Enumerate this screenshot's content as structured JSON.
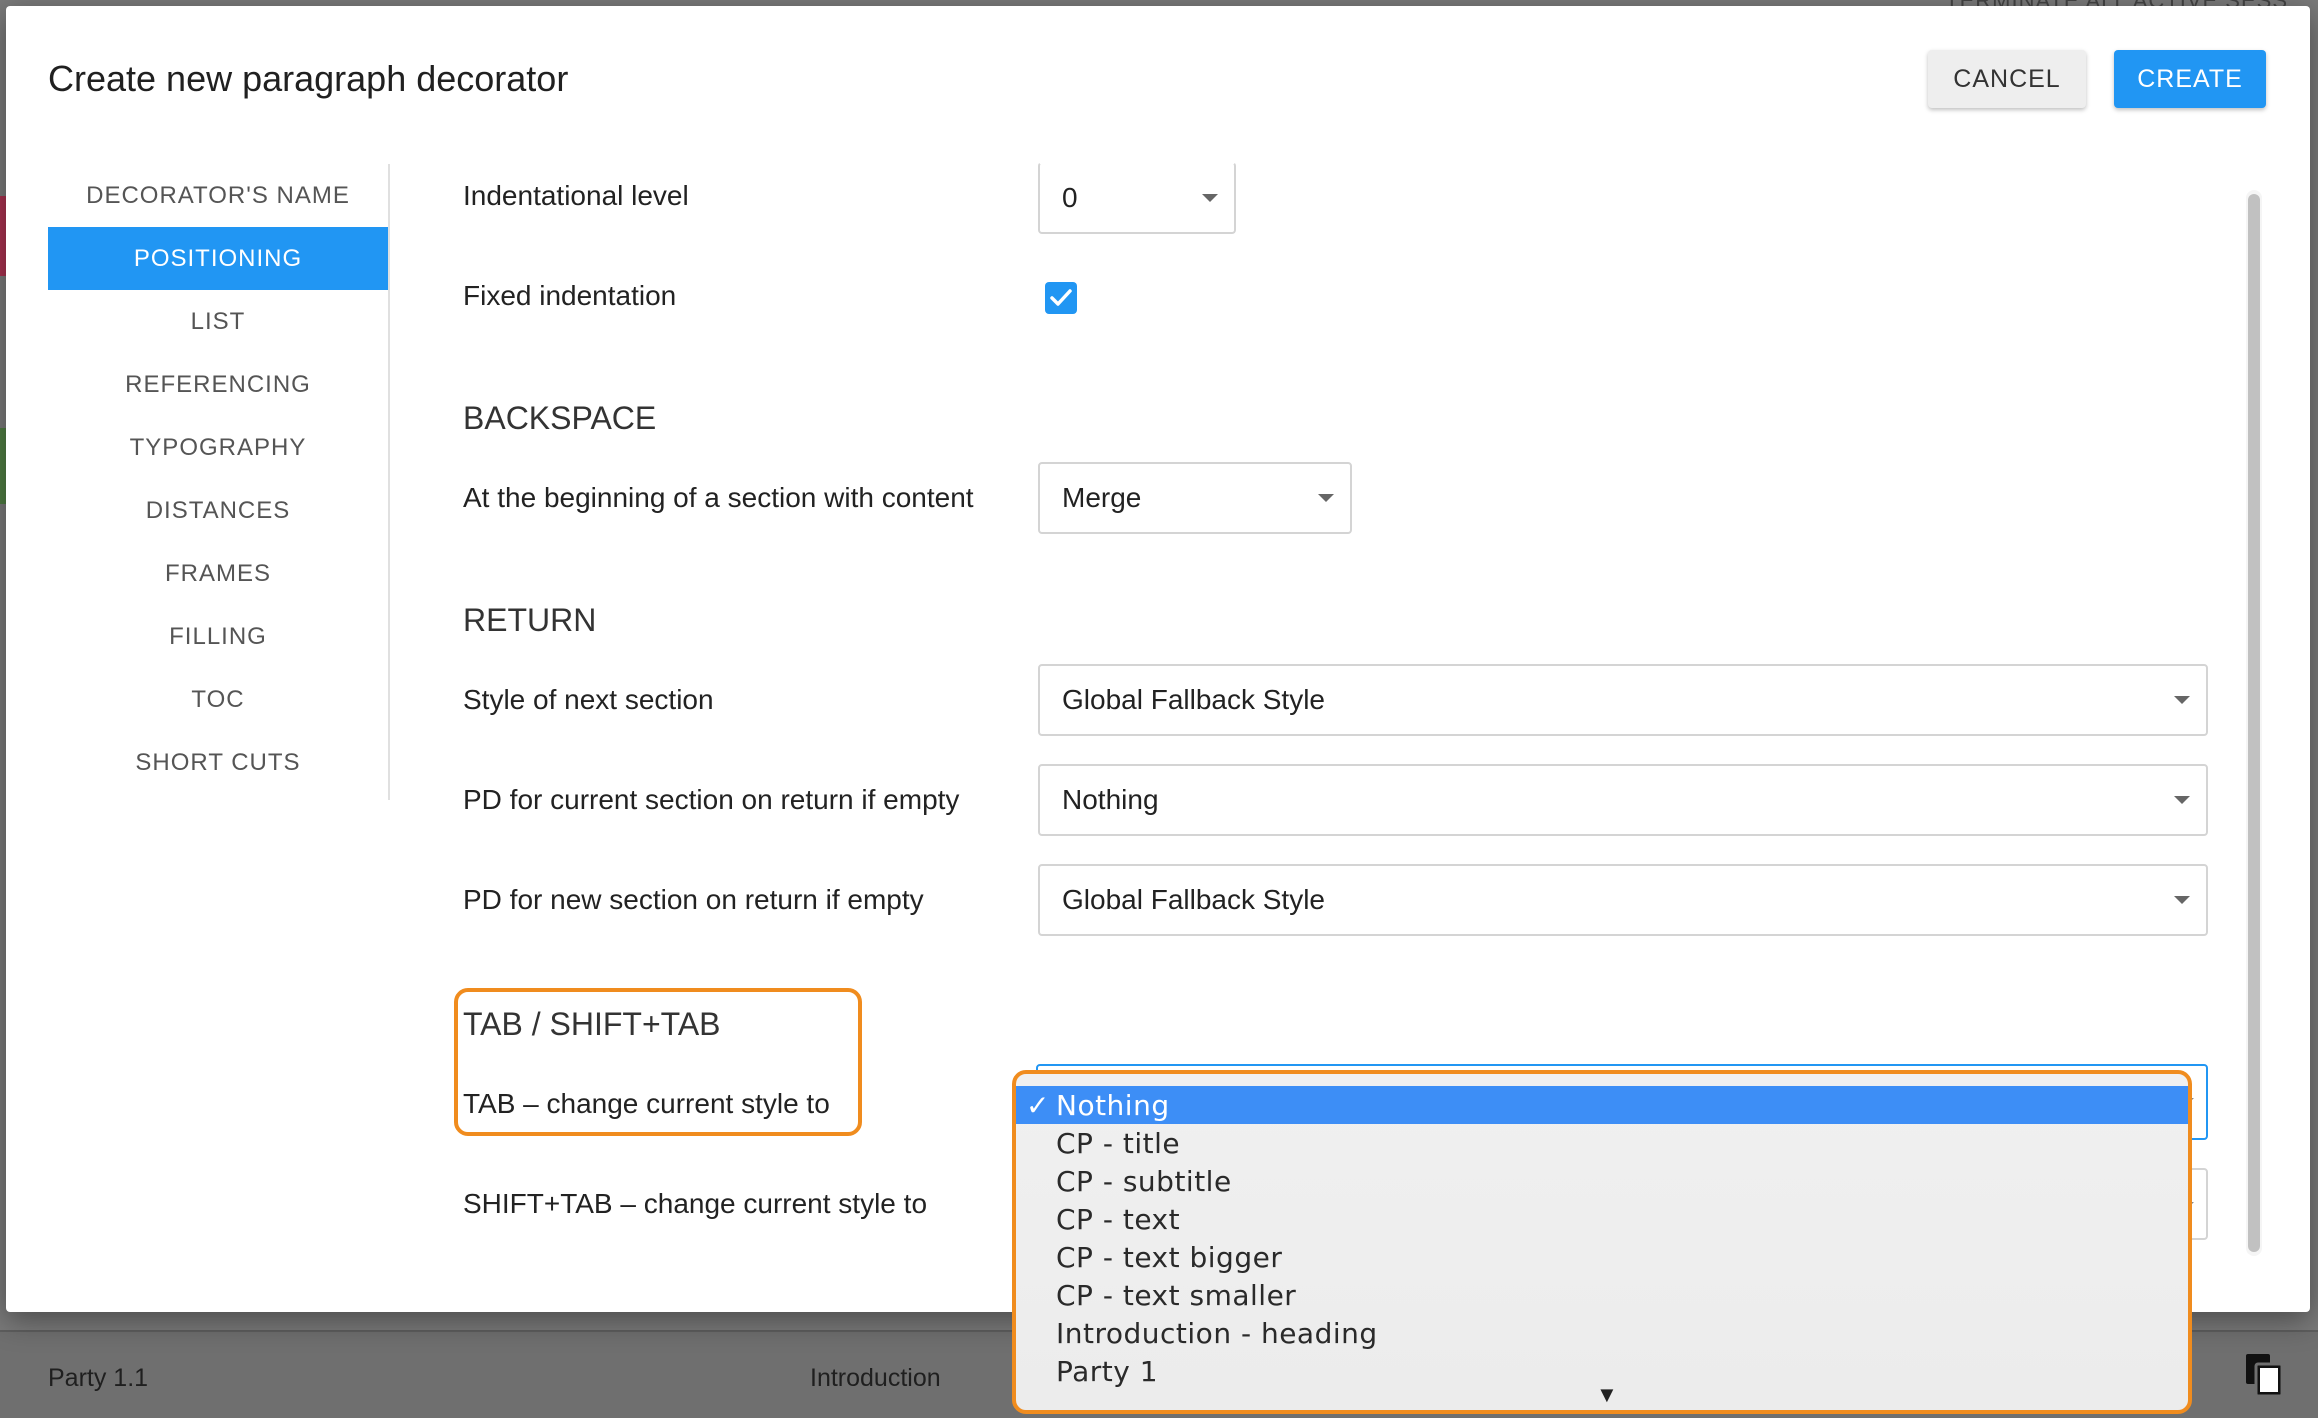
{
  "background": {
    "top_right_text": "TERMINATE ALL ACTIVE SESS",
    "bottom_left": "Party 1.1",
    "bottom_middle": "Introduction"
  },
  "dialog": {
    "title": "Create new paragraph decorator",
    "cancel_label": "CANCEL",
    "create_label": "CREATE"
  },
  "sidenav": {
    "items": [
      {
        "label": "DECORATOR'S NAME",
        "active": false
      },
      {
        "label": "POSITIONING",
        "active": true
      },
      {
        "label": "LIST",
        "active": false
      },
      {
        "label": "REFERENCING",
        "active": false
      },
      {
        "label": "TYPOGRAPHY",
        "active": false
      },
      {
        "label": "DISTANCES",
        "active": false
      },
      {
        "label": "FRAMES",
        "active": false
      },
      {
        "label": "FILLING",
        "active": false
      },
      {
        "label": "TOC",
        "active": false
      },
      {
        "label": "SHORT CUTS",
        "active": false
      }
    ]
  },
  "form": {
    "indentation_label": "Indentational level",
    "indentation_value": "0",
    "fixed_indentation_label": "Fixed indentation",
    "fixed_indentation_checked": true,
    "backspace_heading": "BACKSPACE",
    "backspace_label": "At the beginning of a section with content",
    "backspace_value": "Merge",
    "return_heading": "RETURN",
    "next_style_label": "Style of next section",
    "next_style_value": "Global Fallback Style",
    "pd_current_label": "PD for current section on return if empty",
    "pd_current_value": "Nothing",
    "pd_new_label": "PD for new section on return if empty",
    "pd_new_value": "Global Fallback Style",
    "tab_heading": "TAB / SHIFT+TAB",
    "tab_label": "TAB – change current style to",
    "shift_tab_label": "SHIFT+TAB – change current style to"
  },
  "dropdown": {
    "selected_check": "✓",
    "options": [
      "Nothing",
      "CP - title",
      "CP - subtitle",
      "CP - text",
      "CP - text bigger",
      "CP - text smaller",
      "Introduction - heading",
      "Party 1"
    ],
    "more_indicator": "▼"
  },
  "colors": {
    "accent": "#2196f3",
    "highlight": "#f08c1e"
  }
}
